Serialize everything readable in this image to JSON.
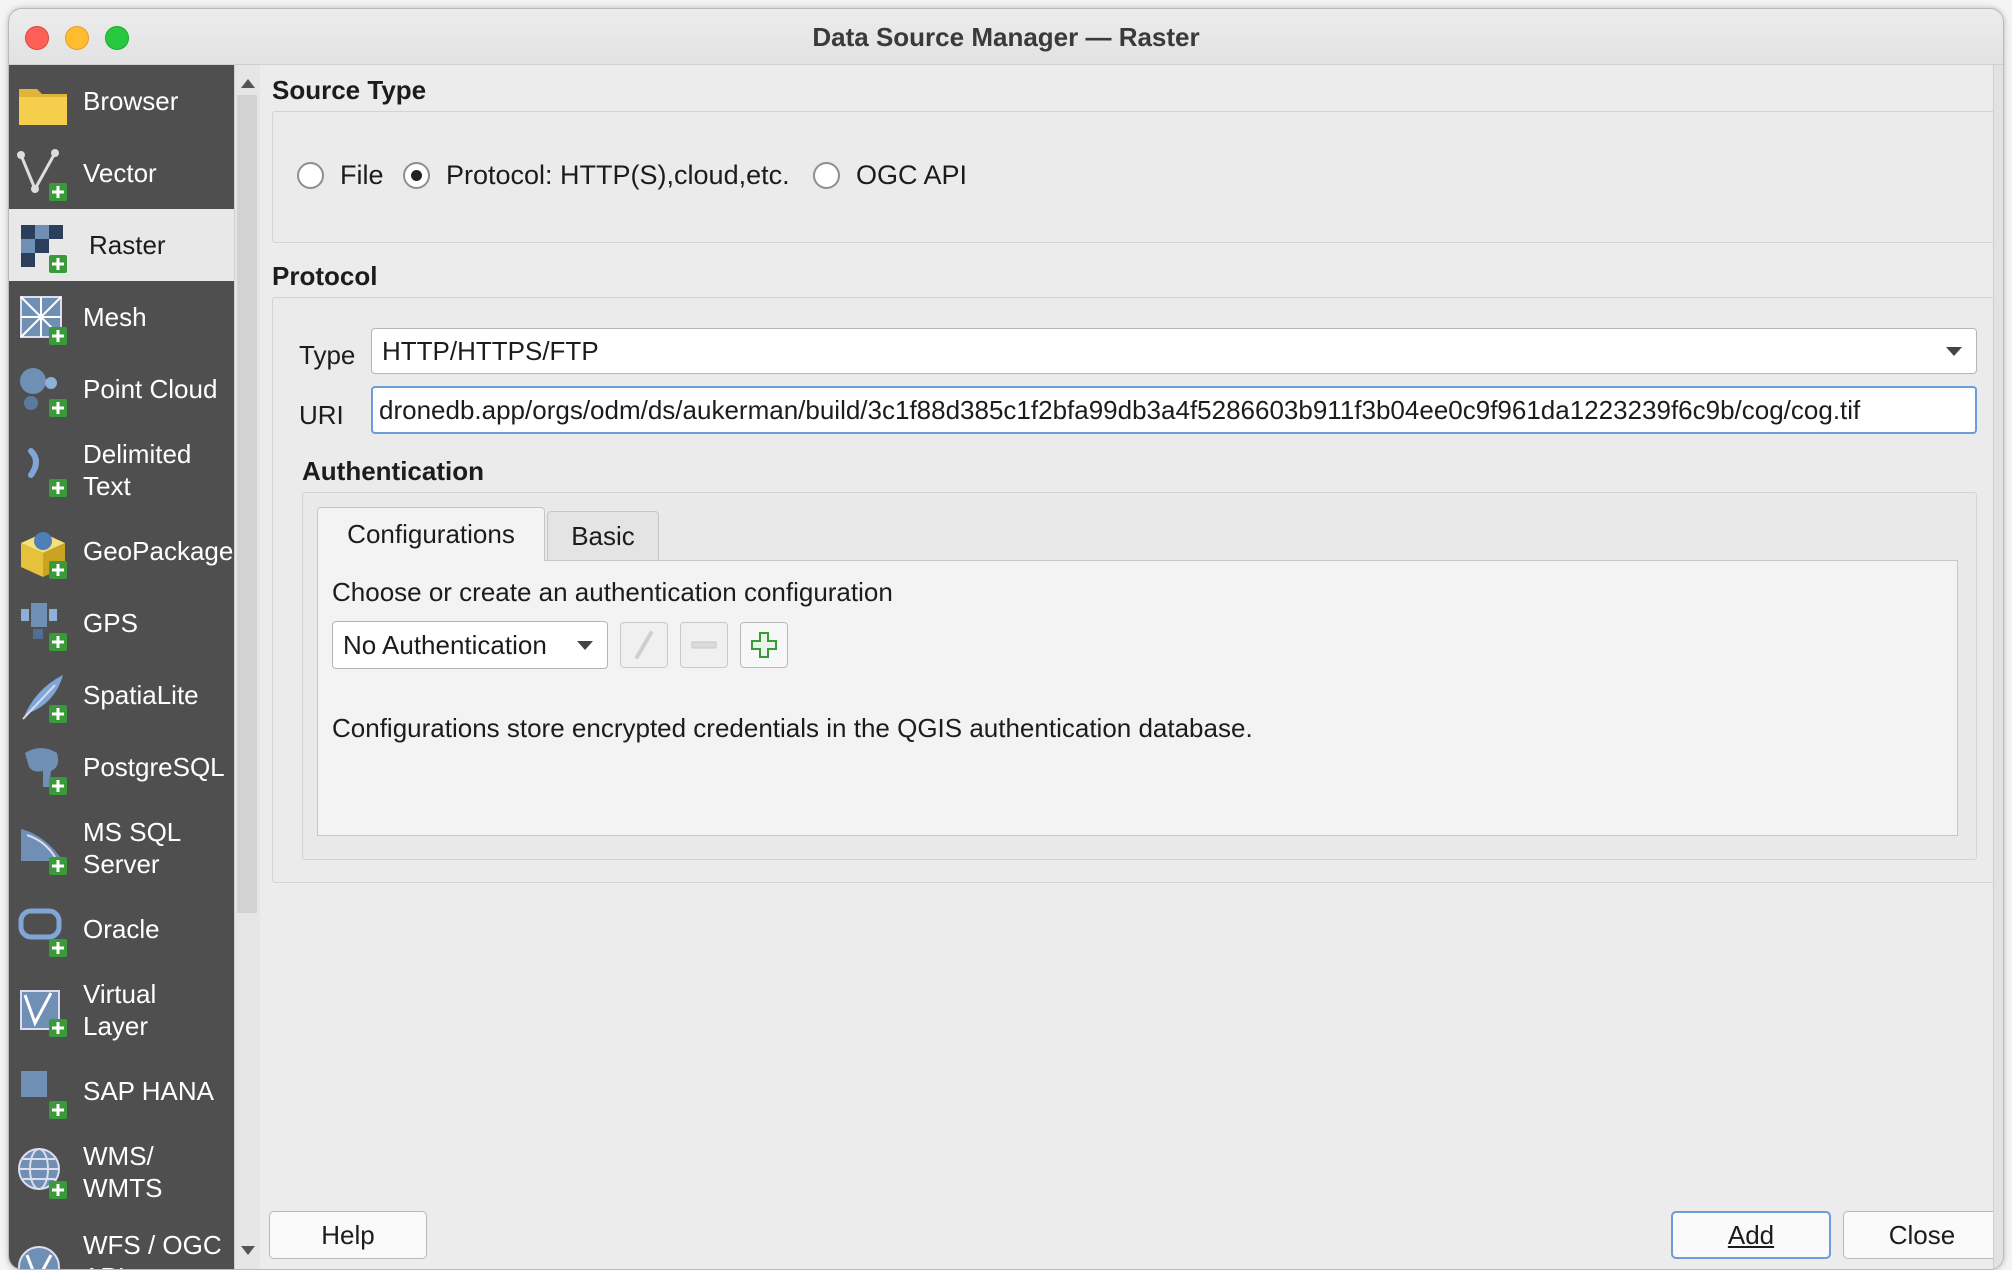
{
  "window": {
    "title": "Data Source Manager — Raster"
  },
  "sidebar": {
    "items": [
      {
        "label": "Browser"
      },
      {
        "label": "Vector"
      },
      {
        "label": "Raster"
      },
      {
        "label": "Mesh"
      },
      {
        "label": "Point Cloud"
      },
      {
        "label": "Delimited\nText"
      },
      {
        "label": "GeoPackage"
      },
      {
        "label": "GPS"
      },
      {
        "label": "SpatiaLite"
      },
      {
        "label": "PostgreSQL"
      },
      {
        "label": "MS SQL\nServer"
      },
      {
        "label": "Oracle"
      },
      {
        "label": "Virtual\nLayer"
      },
      {
        "label": "SAP HANA"
      },
      {
        "label": "WMS/\nWMTS"
      },
      {
        "label": "WFS / OGC\nAPI -\nFeatures"
      }
    ],
    "active": "Raster"
  },
  "source_type": {
    "title": "Source Type",
    "options": [
      "File",
      "Protocol: HTTP(S),cloud,etc.",
      "OGC API"
    ],
    "selected": "Protocol: HTTP(S),cloud,etc."
  },
  "protocol": {
    "title": "Protocol",
    "type_label": "Type",
    "type_value": "HTTP/HTTPS/FTP",
    "uri_label": "URI",
    "uri_value": "dronedb.app/orgs/odm/ds/aukerman/build/3c1f88d385c1f2bfa99db3a4f5286603b911f3b04ee0c9f961da1223239f6c9b/cog/cog.tif"
  },
  "authentication": {
    "title": "Authentication",
    "tabs": [
      "Configurations",
      "Basic"
    ],
    "active_tab": "Configurations",
    "choose_text": "Choose or create an authentication configuration",
    "config_value": "No Authentication",
    "info_text": "Configurations store encrypted credentials in the QGIS authentication database."
  },
  "buttons": {
    "help": "Help",
    "add": "Add",
    "close": "Close"
  },
  "colors": {
    "sidebar_bg": "#4f4f4f",
    "accent": "#6d9cd8",
    "plus_green": "#3a9a3a"
  }
}
